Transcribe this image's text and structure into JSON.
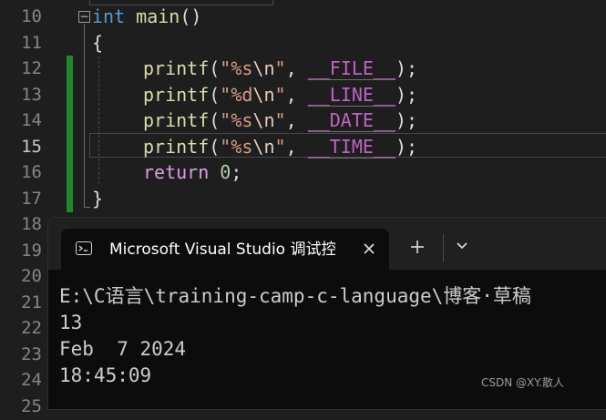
{
  "editor": {
    "line_numbers": [
      "10",
      "11",
      "12",
      "13",
      "14",
      "15",
      "16",
      "17",
      "18",
      "19",
      "20",
      "21",
      "22",
      "23",
      "24",
      "25"
    ],
    "active_line": "15",
    "code": {
      "l10": {
        "kw": "int",
        "fn": "main",
        "rest": "()"
      },
      "l11": "{",
      "l12": {
        "fn": "printf",
        "open": "(",
        "str1": "\"%s",
        "esc": "\\n",
        "str2": "\"",
        "comma": ", ",
        "macro": "__FILE__",
        "close": ");"
      },
      "l13": {
        "fn": "printf",
        "open": "(",
        "str1": "\"%d",
        "esc": "\\n",
        "str2": "\"",
        "comma": ", ",
        "macro": "__LINE__",
        "close": ");"
      },
      "l14": {
        "fn": "printf",
        "open": "(",
        "str1": "\"%s",
        "esc": "\\n",
        "str2": "\"",
        "comma": ", ",
        "macro": "__DATE__",
        "close": ");"
      },
      "l15": {
        "fn": "printf",
        "open": "(",
        "str1": "\"%s",
        "esc": "\\n",
        "str2": "\"",
        "comma": ", ",
        "macro": "__TIME__",
        "close": ");"
      },
      "l16": {
        "kw": "return",
        "num": "0",
        "semi": ";"
      },
      "l17": "}"
    },
    "fold_symbol": "−"
  },
  "terminal": {
    "tab_title": "Microsoft Visual Studio 调试控制台",
    "output": [
      "E:\\C语言\\training-camp-c-language\\博客·草稿",
      "13",
      "Feb  7 2024",
      "18:45:09"
    ]
  },
  "watermark": "CSDN @XY.散人",
  "colors": {
    "editor_bg": "#1e1e1e",
    "keyword": "#569cd6",
    "function": "#dcdcaa",
    "string": "#d69d85",
    "macro": "#bd63c5",
    "control_keyword": "#d8a0df",
    "number": "#b5cea8",
    "change_bar": "#1f8a2c",
    "terminal_bg": "#0c0c0c",
    "tabbar_bg": "#202020"
  },
  "icons": [
    "terminal-icon",
    "close-icon",
    "plus-icon",
    "chevron-down-icon",
    "fold-collapse-icon"
  ]
}
